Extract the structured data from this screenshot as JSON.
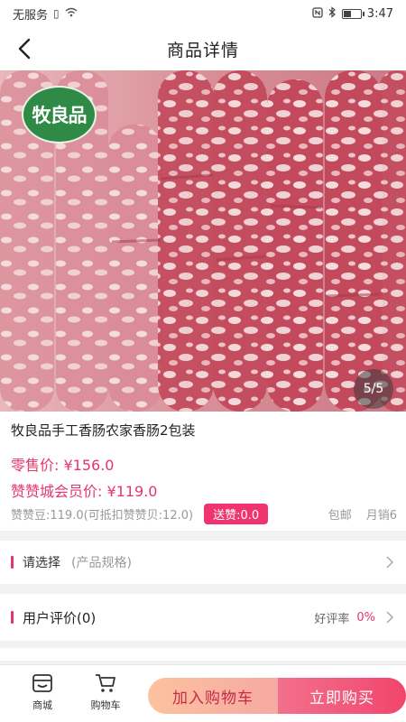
{
  "status_bar": {
    "carrier": "无服务",
    "time": "3:47",
    "icons": [
      "sim-icon",
      "wifi-icon",
      "nfc-icon",
      "bluetooth-icon",
      "battery-icon"
    ]
  },
  "nav": {
    "title": "商品详情",
    "back_icon": "back-arrow-icon"
  },
  "gallery": {
    "logo_text": "牧良品",
    "pager": "5/5"
  },
  "product": {
    "name": "牧良品手工香肠农家香肠2包装",
    "retail_label": "零售价:",
    "retail_price": "¥156.0",
    "member_label": "赞赞城会员价:",
    "member_price": "¥119.0",
    "beans_text": "赞赞豆:119.0(可抵扣赞赞贝:12.0)",
    "gift_tag": "送赞:0.0",
    "shipping": "包邮",
    "monthly_sales": "月销6"
  },
  "select_row": {
    "label": "请选择",
    "sub": "(产品规格)"
  },
  "review_row": {
    "label": "用户评价(0)",
    "rate_label": "好评率",
    "rate_value": "0%"
  },
  "bottom_bar": {
    "mall_label": "商城",
    "cart_label": "购物车",
    "add_to_cart": "加入购物车",
    "buy_now": "立即购买"
  },
  "colors": {
    "accent": "#e6356a",
    "logo_green": "#2f8a45",
    "buy_button": "#f1466c",
    "add_button": "#fcc29f"
  }
}
